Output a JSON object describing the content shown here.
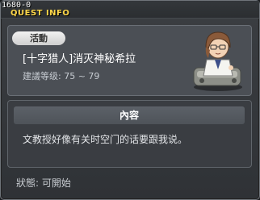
{
  "window": {
    "id_label": "1680-0",
    "title": "QUEST INFO"
  },
  "quest": {
    "tag": "活動",
    "name": "[十字猎人]消灭神秘希拉",
    "level_range": "建議等级: 75 ~ 79"
  },
  "content": {
    "header": "內容",
    "description": "文教授好像有关时空门的话要跟我说。"
  },
  "status": {
    "text": "狀態: 可開始"
  },
  "npc": {
    "icon": "professor-npc-portrait"
  },
  "colors": {
    "title": "#ffd84a",
    "panel": "#4b4f55",
    "header": "#5c6168"
  }
}
